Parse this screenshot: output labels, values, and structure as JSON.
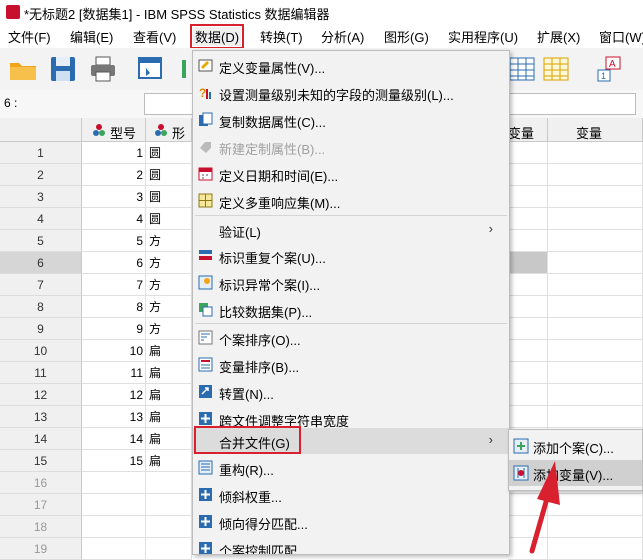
{
  "window": {
    "title": "*无标题2 [数据集1] - IBM SPSS Statistics 数据编辑器"
  },
  "menubar": [
    {
      "label": "文件(F)"
    },
    {
      "label": "编辑(E)"
    },
    {
      "label": "查看(V)"
    },
    {
      "label": "数据(D)"
    },
    {
      "label": "转换(T)"
    },
    {
      "label": "分析(A)"
    },
    {
      "label": "图形(G)"
    },
    {
      "label": "实用程序(U)"
    },
    {
      "label": "扩展(X)"
    },
    {
      "label": "窗口(W)"
    }
  ],
  "cellbar": {
    "ref": "6 :"
  },
  "grid": {
    "columns": [
      "型号",
      "形",
      "变量",
      "变量"
    ],
    "rows": [
      {
        "n": "1",
        "v": "1",
        "s": "圆"
      },
      {
        "n": "2",
        "v": "2",
        "s": "圆"
      },
      {
        "n": "3",
        "v": "3",
        "s": "圆"
      },
      {
        "n": "4",
        "v": "4",
        "s": "圆"
      },
      {
        "n": "5",
        "v": "5",
        "s": "方"
      },
      {
        "n": "6",
        "v": "6",
        "s": "方"
      },
      {
        "n": "7",
        "v": "7",
        "s": "方"
      },
      {
        "n": "8",
        "v": "8",
        "s": "方"
      },
      {
        "n": "9",
        "v": "9",
        "s": "方"
      },
      {
        "n": "10",
        "v": "10",
        "s": "扁"
      },
      {
        "n": "11",
        "v": "11",
        "s": "扁"
      },
      {
        "n": "12",
        "v": "12",
        "s": "扁"
      },
      {
        "n": "13",
        "v": "13",
        "s": "扁"
      },
      {
        "n": "14",
        "v": "14",
        "s": "扁"
      },
      {
        "n": "15",
        "v": "15",
        "s": "扁"
      },
      {
        "n": "16",
        "v": "",
        "s": ""
      },
      {
        "n": "17",
        "v": "",
        "s": ""
      },
      {
        "n": "18",
        "v": "",
        "s": ""
      },
      {
        "n": "19",
        "v": "",
        "s": ""
      }
    ]
  },
  "data_menu": {
    "items": [
      {
        "label": "定义变量属性(V)...",
        "icon": "define-variable-icon"
      },
      {
        "label": "设置测量级别未知的字段的测量级别(L)...",
        "icon": "measure-level-icon"
      },
      {
        "label": "复制数据属性(C)...",
        "icon": "copy-properties-icon"
      },
      {
        "label": "新建定制属性(B)...",
        "icon": "custom-attribute-icon"
      },
      {
        "label": "定义日期和时间(E)...",
        "icon": "calendar-icon"
      },
      {
        "label": "定义多重响应集(M)...",
        "icon": "multi-response-icon"
      },
      {
        "label": "验证(L)",
        "icon": ""
      },
      {
        "label": "标识重复个案(U)...",
        "icon": "duplicate-cases-icon"
      },
      {
        "label": "标识异常个案(I)...",
        "icon": "unusual-cases-icon"
      },
      {
        "label": "比较数据集(P)...",
        "icon": "compare-datasets-icon"
      },
      {
        "label": "个案排序(O)...",
        "icon": "sort-cases-icon"
      },
      {
        "label": "变量排序(B)...",
        "icon": "sort-variables-icon"
      },
      {
        "label": "转置(N)...",
        "icon": "transpose-icon"
      },
      {
        "label": "跨文件调整字符串宽度",
        "icon": "string-width-icon"
      },
      {
        "label": "合并文件(G)",
        "icon": ""
      },
      {
        "label": "重构(R)...",
        "icon": "restructure-icon"
      },
      {
        "label": "倾斜权重...",
        "icon": "rake-weights-icon"
      },
      {
        "label": "倾向得分匹配...",
        "icon": "propensity-icon"
      },
      {
        "label": "个案控制匹配",
        "icon": "case-control-icon"
      }
    ]
  },
  "merge_submenu": {
    "items": [
      {
        "label": "添加个案(C)...",
        "icon": "add-cases-icon"
      },
      {
        "label": "添加变量(V)...",
        "icon": "add-variables-icon"
      }
    ]
  },
  "colors": {
    "highlight_red": "#d9202f",
    "menu_bg": "#f2f2f2"
  }
}
